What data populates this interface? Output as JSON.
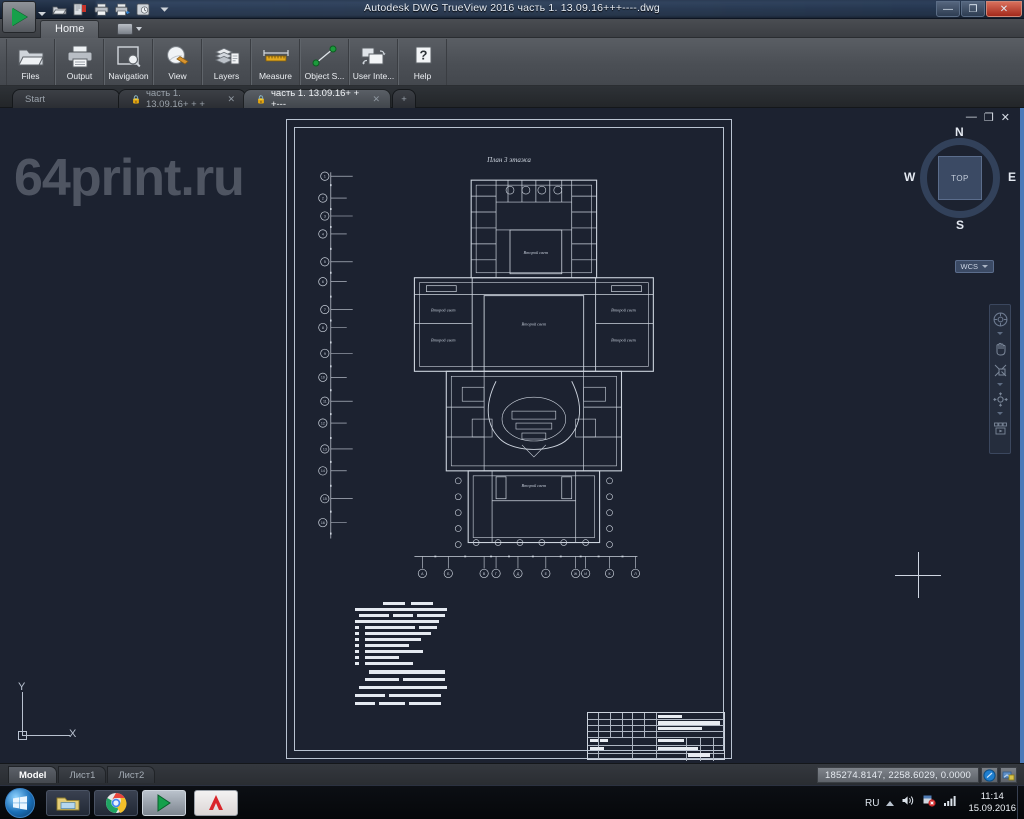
{
  "window": {
    "title": "Autodesk DWG TrueView 2016    часть 1. 13.09.16+++----.dwg",
    "minimize": "—",
    "maximize": "❐",
    "close": "✕"
  },
  "quick_access": {
    "app_button": "app-menu",
    "items": [
      {
        "name": "open-icon",
        "label": "Open"
      },
      {
        "name": "export-pdf-icon",
        "label": "Export PDF"
      },
      {
        "name": "print-icon",
        "label": "Print"
      },
      {
        "name": "plot-icon",
        "label": "Plot"
      },
      {
        "name": "save-as-icon",
        "label": "Save As"
      },
      {
        "name": "customize-caret-icon",
        "label": "Customize"
      }
    ]
  },
  "ribbon": {
    "tab_label": "Home",
    "buttons": [
      {
        "label": "Files",
        "icon": "folder-icon"
      },
      {
        "label": "Output",
        "icon": "printer-icon"
      },
      {
        "label": "Navigation",
        "icon": "zoom-window-icon"
      },
      {
        "label": "View",
        "icon": "visual-style-icon"
      },
      {
        "label": "Layers",
        "icon": "layers-icon"
      },
      {
        "label": "Measure",
        "icon": "ruler-icon"
      },
      {
        "label": "Object S...",
        "icon": "object-snap-icon"
      },
      {
        "label": "User Inte...",
        "icon": "user-interface-icon"
      },
      {
        "label": "Help",
        "icon": "help-icon"
      }
    ]
  },
  "file_tabs": [
    {
      "label": "Start",
      "active": false,
      "closeable": false,
      "locked": false
    },
    {
      "label": "часть 1. 13.09.16+ + +",
      "active": false,
      "closeable": true,
      "locked": true
    },
    {
      "label": "часть 1. 13.09.16+ + +---",
      "active": true,
      "closeable": true,
      "locked": true
    }
  ],
  "new_tab_label": "+",
  "canvas": {
    "watermark": "64print.ru",
    "window_controls": {
      "minimize": "—",
      "restore": "❐",
      "close": "✕"
    },
    "drawing": {
      "plan_title": "План 3 этажа",
      "room_labels": [
        "Второй свет",
        "Второй свет",
        "Второй свет",
        "Второй свет",
        "Второй свет",
        "Второй свет",
        "Второй свет"
      ],
      "horizontal_grid_bubbles": [
        "1",
        "2",
        "3",
        "4",
        "5",
        "6",
        "7",
        "8",
        "9",
        "10",
        "11",
        "12",
        "13"
      ],
      "vertical_grid_bubbles": [
        "А",
        "Б",
        "В",
        "Г",
        "Д",
        "Е",
        "Ж",
        "И",
        "К",
        "Л",
        "М",
        "Н",
        "П",
        "Р",
        "С"
      ]
    },
    "viewcube": {
      "face": "TOP",
      "north": "N",
      "east": "E",
      "south": "S",
      "west": "W",
      "ucs_label": "WCS"
    },
    "navbar": [
      {
        "name": "steering-wheel-icon",
        "label": "Full Navigation Wheel"
      },
      {
        "name": "pan-hand-icon",
        "label": "Pan"
      },
      {
        "name": "zoom-extents-icon",
        "label": "Zoom"
      },
      {
        "name": "orbit-icon",
        "label": "Orbit"
      },
      {
        "name": "showmotion-icon",
        "label": "ShowMotion"
      }
    ],
    "ucs_icon": {
      "x_label": "X",
      "y_label": "Y"
    }
  },
  "status_bar": {
    "layout_tabs": [
      {
        "label": "Model",
        "active": true
      },
      {
        "label": "Лист1",
        "active": false
      },
      {
        "label": "Лист2",
        "active": false
      }
    ],
    "coordinates": "185274.8147, 2258.6029, 0.0000",
    "icons": [
      {
        "name": "annotation-visibility-icon"
      },
      {
        "name": "toolbar-lock-icon"
      }
    ]
  },
  "taskbar": {
    "start_label": "Start",
    "buttons": [
      {
        "name": "taskbar-explorer",
        "label": "Windows Explorer"
      },
      {
        "name": "taskbar-chrome",
        "label": "Google Chrome"
      },
      {
        "name": "taskbar-dwg-trueview",
        "label": "DWG TrueView"
      },
      {
        "name": "taskbar-autocad",
        "label": "AutoCAD"
      }
    ],
    "tray": {
      "language": "RU",
      "time": "11:14",
      "date": "15.09.2016"
    }
  }
}
